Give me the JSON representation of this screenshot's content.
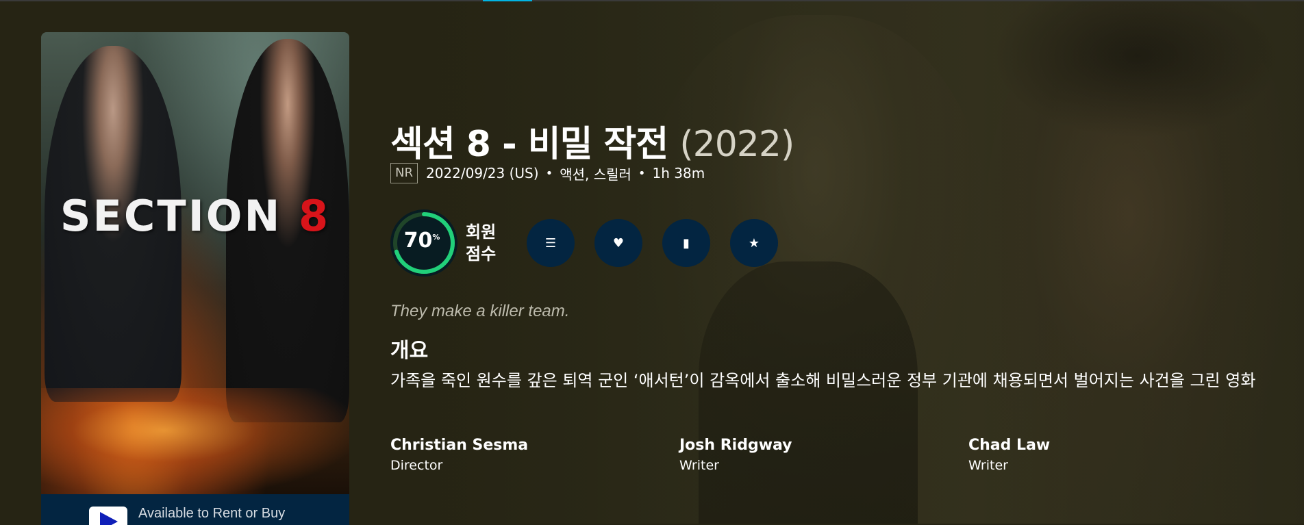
{
  "poster": {
    "art_text": "SECTION",
    "art_number": "8",
    "rent_label": "Available to Rent or Buy"
  },
  "movie": {
    "title": "섹션 8 - 비밀 작전",
    "year": "(2022)",
    "certification": "NR",
    "release": "2022/09/23 (US)",
    "genres": "액션, 스릴러",
    "runtime": "1h 38m",
    "score": {
      "value": "70",
      "percent_sign": "%",
      "fraction": 0.7,
      "label_line1": "회원",
      "label_line2": "점수",
      "ring_color": "#21d07a",
      "track_color": "#204529"
    },
    "tagline": "They make a killer team.",
    "overview_heading": "개요",
    "overview": "가족을 죽인 원수를 갚은 퇴역 군인 ‘애서턴’이 감옥에서 출소해 비밀스러운 정부 기관에 채용되면서 벌어지는 사건을 그린 영화"
  },
  "actions": [
    {
      "name": "add-to-list-button",
      "icon": "list-icon",
      "glyph": "☰"
    },
    {
      "name": "favorite-button",
      "icon": "heart-icon",
      "glyph": "♥"
    },
    {
      "name": "watchlist-button",
      "icon": "bookmark-icon",
      "glyph": "▮"
    },
    {
      "name": "rate-button",
      "icon": "star-icon",
      "glyph": "★"
    }
  ],
  "crew": [
    {
      "name": "Christian Sesma",
      "job": "Director"
    },
    {
      "name": "Josh Ridgway",
      "job": "Writer"
    },
    {
      "name": "Chad Law",
      "job": "Writer"
    }
  ],
  "colors": {
    "background": "#262414",
    "button": "#032541",
    "accent": "#01b4e4"
  }
}
